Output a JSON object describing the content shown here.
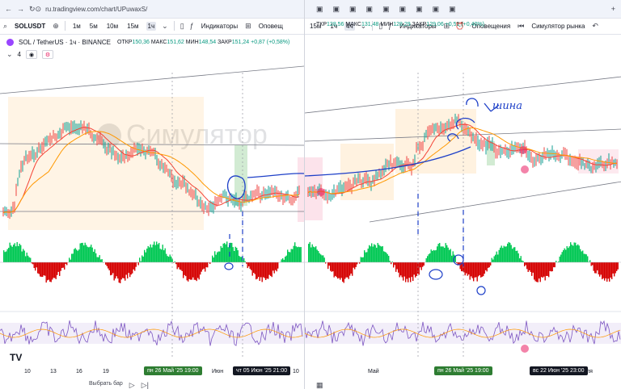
{
  "left": {
    "url": "ru.tradingview.com/chart/UPuwaxS/",
    "symbol": "SOLUSDT",
    "intervals": [
      "1м",
      "5м",
      "10м",
      "15м",
      "1ч"
    ],
    "active_interval": "1ч",
    "indicators_label": "Индикаторы",
    "alerts_label": "Оповещ",
    "pair_title": "SOL / TetherUS · 1ч · BINANCE",
    "ohlc": {
      "o_label": "ОТКР",
      "o": "150,36",
      "h_label": "МАКС",
      "h": "151,62",
      "l_label": "МИН",
      "l": "148,54",
      "c_label": "ЗАКР",
      "c": "151,24",
      "chg": "+0,87 (+0,58%)"
    },
    "indicator_count": "4",
    "watermark": "Симулятор",
    "time_labels": [
      "10",
      "13",
      "16",
      "19",
      "Июн",
      "10"
    ],
    "date_badge_1": "пн 26 Май '25   19:00",
    "date_badge_2": "чт 05 Июн '25   21:00",
    "bottom_text": "Выбрать бар"
  },
  "right": {
    "intervals": [
      "15м",
      "1ч",
      "4ч"
    ],
    "indicators_label": "Индикаторы",
    "alerts_label": "Оповещения",
    "simulator_label": "Симулятор рынка",
    "ohlc": {
      "o_label": "ТКР",
      "o": "128,56",
      "h_label": "МАКС",
      "h": "131,48",
      "l_label": "МИН",
      "l": "128,29",
      "c_label": "ЗАКР",
      "c": "129,06",
      "chg": "+0,51 (+0,40%)"
    },
    "handwriting": "шина",
    "time_labels": [
      "Май",
      "ля"
    ],
    "date_badge_1": "пн 26 Май '25   19:00",
    "date_badge_2": "вс 22 Июн '25   23:00"
  },
  "colors": {
    "up": "#00c853",
    "down": "#d50000",
    "rsi": "#7e57c2",
    "ema1": "#f44336",
    "ema2": "#ff9800",
    "ink": "#1e40c8",
    "badge_green": "#2e7d32",
    "badge_dark": "#131722"
  }
}
